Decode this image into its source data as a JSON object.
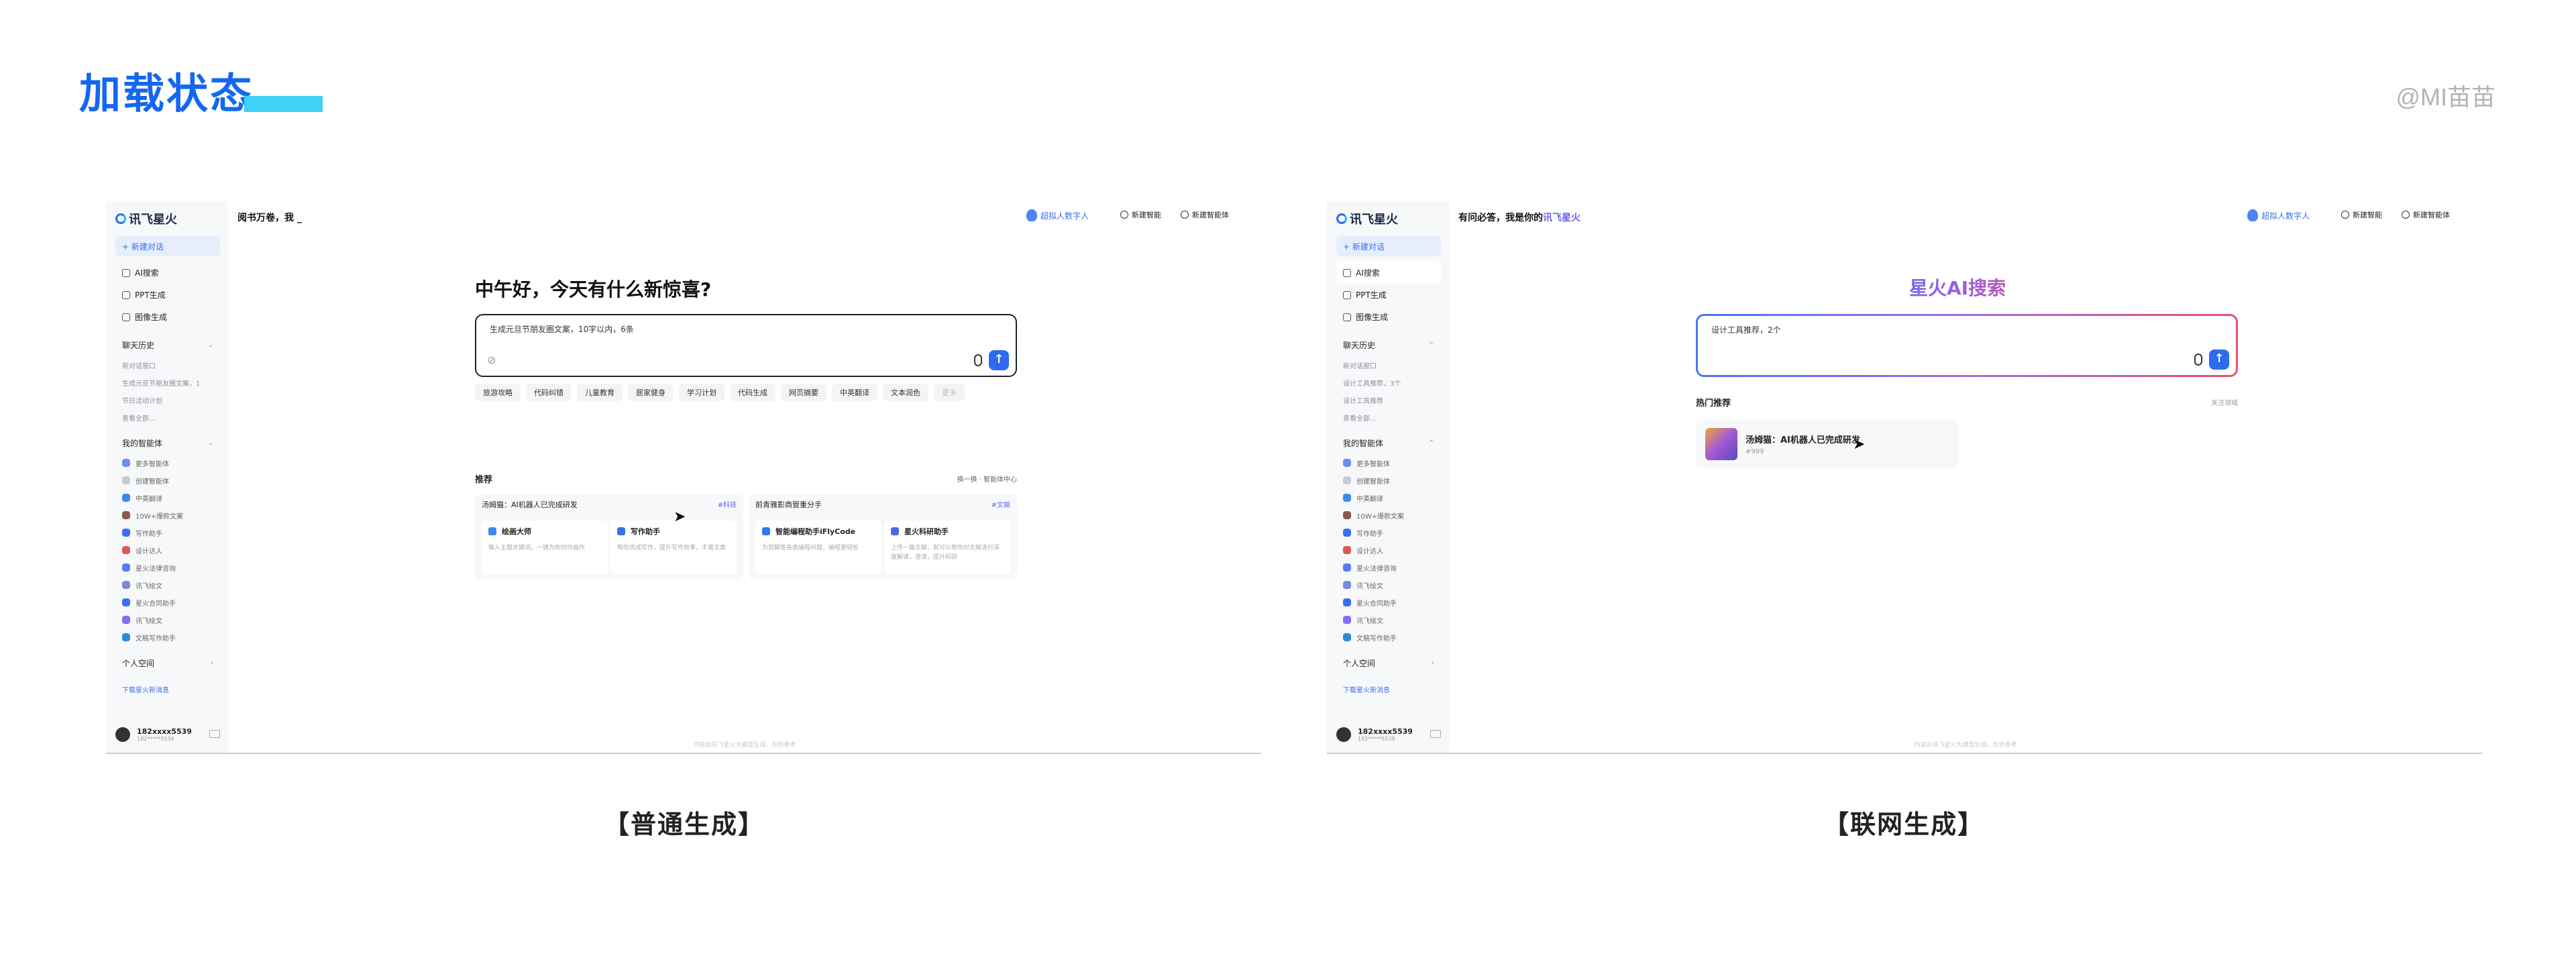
{
  "page": {
    "title": "加载状态",
    "watermark": "@MI苗苗",
    "caption_left": "【普通生成】",
    "caption_right": "【联网生成】"
  },
  "sidebar": {
    "logo": "讯飞星火",
    "new_chat": "+ 新建对话",
    "nav": [
      "AI搜索",
      "PPT生成",
      "图像生成"
    ],
    "history_label": "聊天历史",
    "my_agents_label": "我的智能体",
    "agents": [
      "更多智能体",
      "创建智能体",
      "中英翻译",
      "10W+爆款文案",
      "写作助手",
      "设计达人",
      "星火法律咨询",
      "讯飞绘文",
      "星火合同助手",
      "讯飞绘文",
      "文稿写作助手"
    ],
    "personal_space": "个人空间",
    "download": "下载星火新消息",
    "user_name": "182xxxx5539",
    "user_sub": "182*****5539"
  },
  "shot1": {
    "slogan": "阅书万卷，我 _",
    "history": [
      "新对话窗口",
      "生成元旦节朋友圈文案，1",
      "节日活动计划",
      "查看全部..."
    ],
    "topbar": {
      "digital": "超拟人数字人",
      "new_agent": "新建智能",
      "new_expert": "新建智能体"
    },
    "greeting": "中午好，今天有什么新惊喜?",
    "input_text": "生成元旦节朋友圈文案，10字以内，6条",
    "chips": [
      "旅游攻略",
      "代码纠错",
      "儿童教育",
      "居家健身",
      "学习计划",
      "代码生成",
      "网页摘要",
      "中英翻译",
      "文本润色",
      "更多"
    ],
    "rec_title": "推荐",
    "rec_right": "换一换 · 智能体中心",
    "cards": [
      {
        "title": "汤姆猫：AI机器人已完成研发",
        "tag": "#科技",
        "subs": [
          {
            "t": "绘画大师",
            "d": "输入主题关键词，一键为你创作画作"
          },
          {
            "t": "写作助手",
            "d": "帮你完成写作，提升写作效率，丰富文章"
          }
        ]
      },
      {
        "title": "前青雅影商管重分手",
        "tag": "#文娱",
        "subs": [
          {
            "t": "智能编程助手iFlyCode",
            "d": "为您解答各类编程问题，编程更轻松"
          },
          {
            "t": "星火科研助手",
            "d": "上传一篇文献，就可以帮你对文献进行深度解读，速读，提升科研"
          }
        ]
      }
    ],
    "footer": "内容由讯飞星火大模型生成，仅供参考"
  },
  "shot2": {
    "slogan_main": "有问必答，我是你的",
    "slogan_hl": "讯飞星火",
    "history": [
      "新对话窗口",
      "设计工具推荐，3个",
      "设计工具推荐",
      "查看全部..."
    ],
    "topbar": {
      "digital": "超拟人数字人",
      "new_agent": "新建智能",
      "new_expert": "新建智能体"
    },
    "search_title": "星火AI搜索",
    "input_text": "设计工具推荐，2个",
    "hot_title": "热门推荐",
    "hot_right": "关注领域",
    "hot_item": {
      "title": "汤姆猫：AI机器人已完成研发",
      "sub": "#999"
    },
    "footer": "内容由讯飞星火大模型生成，仅供参考"
  }
}
